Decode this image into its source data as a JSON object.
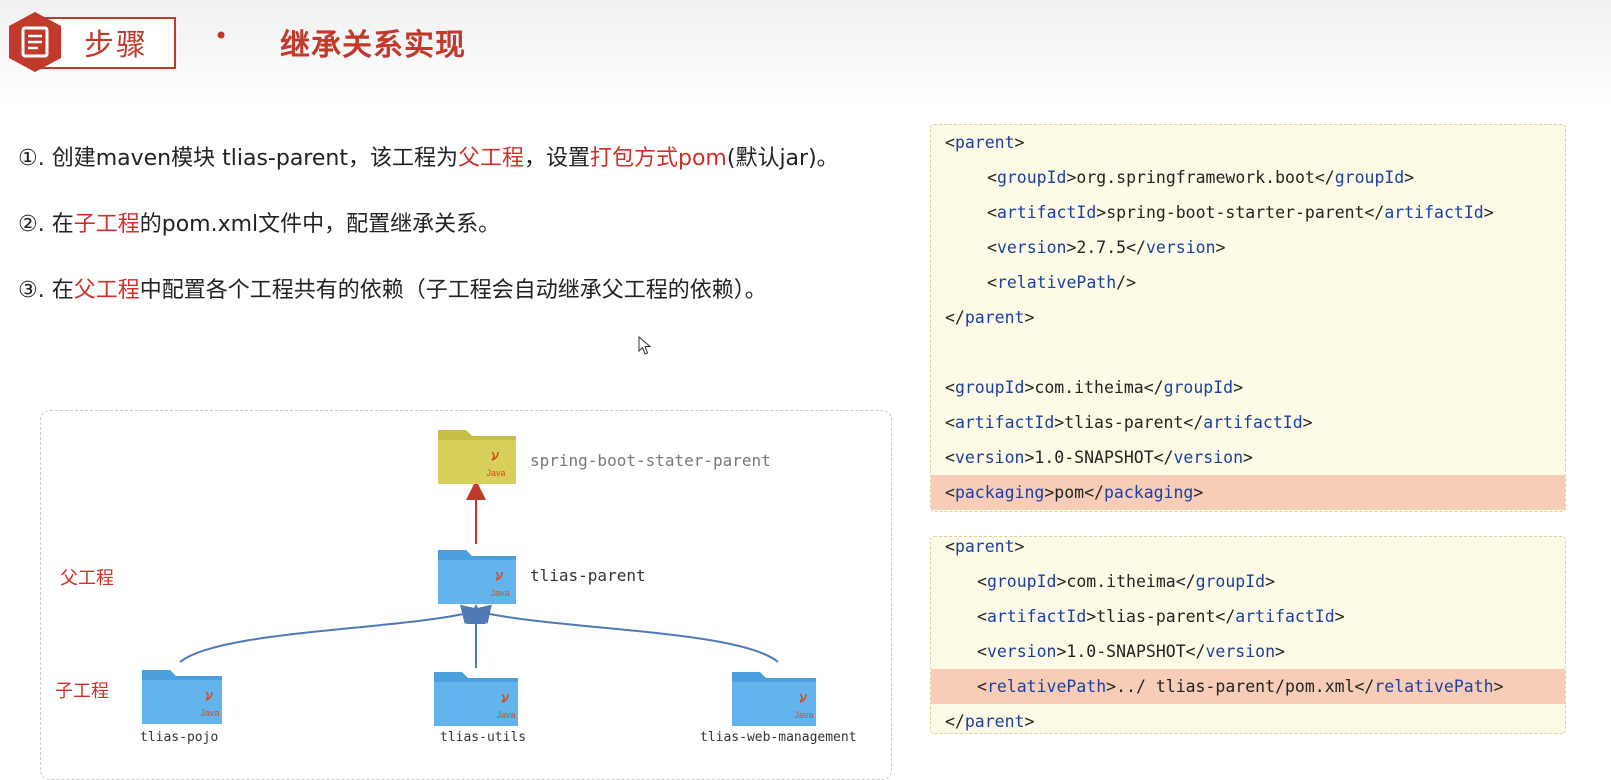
{
  "header": {
    "step_label": "步骤",
    "bullet": "•",
    "title": "继承关系实现",
    "icon": "document-icon"
  },
  "steps": [
    {
      "num": "①.",
      "p1": "创建maven模块 tlias-parent，该工程为",
      "h1": "父工程",
      "p2": "，设置",
      "h2": "打包方式pom",
      "p3": "(默认jar)。"
    },
    {
      "num": "②.",
      "p1": "在",
      "h1": "子工程",
      "p2": "的pom.xml文件中，配置继承关系。"
    },
    {
      "num": "③.",
      "p1": "在",
      "h1": "父工程",
      "p2": "中配置各个工程共有的依赖（子工程会自动继承父工程的依赖）。"
    }
  ],
  "diagram": {
    "parent_label": "父工程",
    "child_label": "子工程",
    "root": {
      "name": "spring-boot-stater-parent",
      "icon": "java-folder-icon"
    },
    "parent": {
      "name": "tlias-parent",
      "icon": "java-folder-icon"
    },
    "children": [
      {
        "name": "tlias-pojo",
        "icon": "java-folder-icon"
      },
      {
        "name": "tlias-utils",
        "icon": "java-folder-icon"
      },
      {
        "name": "tlias-web-management",
        "icon": "java-folder-icon"
      }
    ],
    "java_text": "Java"
  },
  "code_parent": [
    {
      "tag": "parent",
      "open": true
    },
    {
      "tag": "groupId",
      "value": "org.springframework.boot"
    },
    {
      "tag": "artifactId",
      "value": "spring-boot-starter-parent"
    },
    {
      "tag": "version",
      "value": "2.7.5"
    },
    {
      "tag": "relativePath",
      "self": true
    },
    {
      "tag": "parent",
      "close": true
    },
    {
      "blank": true
    },
    {
      "tag": "groupId",
      "value": "com.itheima"
    },
    {
      "tag": "artifactId",
      "value": "tlias-parent"
    },
    {
      "tag": "version",
      "value": "1.0-SNAPSHOT"
    },
    {
      "tag": "packaging",
      "value": "pom",
      "highlight": true
    }
  ],
  "code_child": [
    {
      "tag": "parent",
      "open": true
    },
    {
      "tag": "groupId",
      "value": "com.itheima"
    },
    {
      "tag": "artifactId",
      "value": "tlias-parent"
    },
    {
      "tag": "version",
      "value": "1.0-SNAPSHOT"
    },
    {
      "tag": "relativePath",
      "value": "../ tlias-parent/pom.xml",
      "highlight": true
    },
    {
      "tag": "parent",
      "close": true
    }
  ],
  "colors": {
    "accent": "#c0392b",
    "highlight_text": "#d0302a",
    "tag": "#1b3f9e",
    "panel_bg": "#fdfbe6",
    "row_highlight": "#f7cdb8",
    "folder_blue": "#5aaee8",
    "folder_olive": "#c4bd47",
    "arrow_red": "#c0392b",
    "arrow_blue": "#4f7bb5"
  }
}
